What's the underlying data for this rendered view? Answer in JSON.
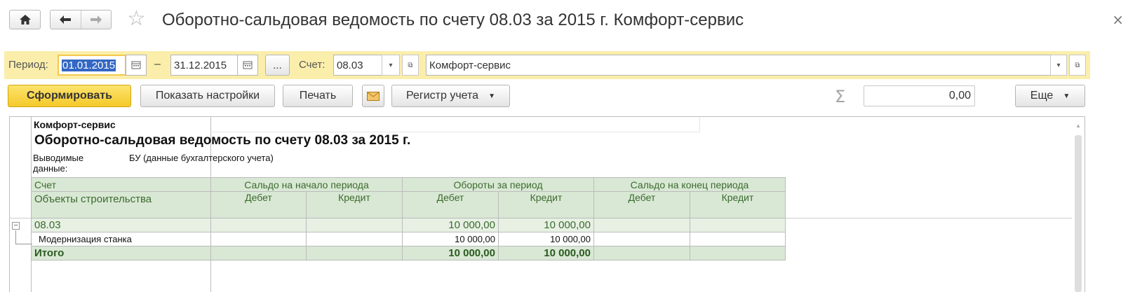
{
  "window": {
    "title": "Оборотно-сальдовая ведомость по счету 08.03 за 2015 г. Комфорт-сервис",
    "close": "×"
  },
  "filters": {
    "period_label": "Период:",
    "date_from": "01.01.2015",
    "separator": "–",
    "date_to": "31.12.2015",
    "period_more": "...",
    "account_label": "Счет:",
    "account_value": "08.03",
    "organization_value": "Комфорт-сервис"
  },
  "toolbar": {
    "generate": "Сформировать",
    "show_settings": "Показать настройки",
    "print": "Печать",
    "register": "Регистр учета",
    "sum_value": "0,00",
    "more": "Еще"
  },
  "report": {
    "organization": "Комфорт-сервис",
    "title": "Оборотно-сальдовая ведомость по счету 08.03 за 2015 г.",
    "output_label": "Выводимые данные:",
    "output_value": "БУ (данные бухгалтерского учета)",
    "headers": {
      "account": "Счет",
      "objects": "Объекты строительства",
      "opening": "Сальдо на начало периода",
      "turnover": "Обороты за период",
      "closing": "Сальдо на конец периода",
      "debit": "Дебет",
      "credit": "Кредит"
    },
    "rows": [
      {
        "name": "08.03",
        "open_d": "",
        "open_c": "",
        "turn_d": "10 000,00",
        "turn_c": "10 000,00",
        "close_d": "",
        "close_c": ""
      },
      {
        "name": "Модернизация станка",
        "open_d": "",
        "open_c": "",
        "turn_d": "10 000,00",
        "turn_c": "10 000,00",
        "close_d": "",
        "close_c": ""
      }
    ],
    "total": {
      "name": "Итого",
      "open_d": "",
      "open_c": "",
      "turn_d": "10 000,00",
      "turn_c": "10 000,00",
      "close_d": "",
      "close_c": ""
    }
  },
  "colors": {
    "filter_bar": "#fbeeab",
    "primary_button": "#f4c92a",
    "table_header": "#d9e8d4",
    "table_text": "#3b6b2f"
  },
  "icons": [
    "home-icon",
    "back-arrow-icon",
    "forward-arrow-icon",
    "star-icon",
    "close-icon",
    "calendar-icon",
    "dropdown-icon",
    "open-icon",
    "mail-icon",
    "sigma-icon",
    "collapse-icon"
  ]
}
